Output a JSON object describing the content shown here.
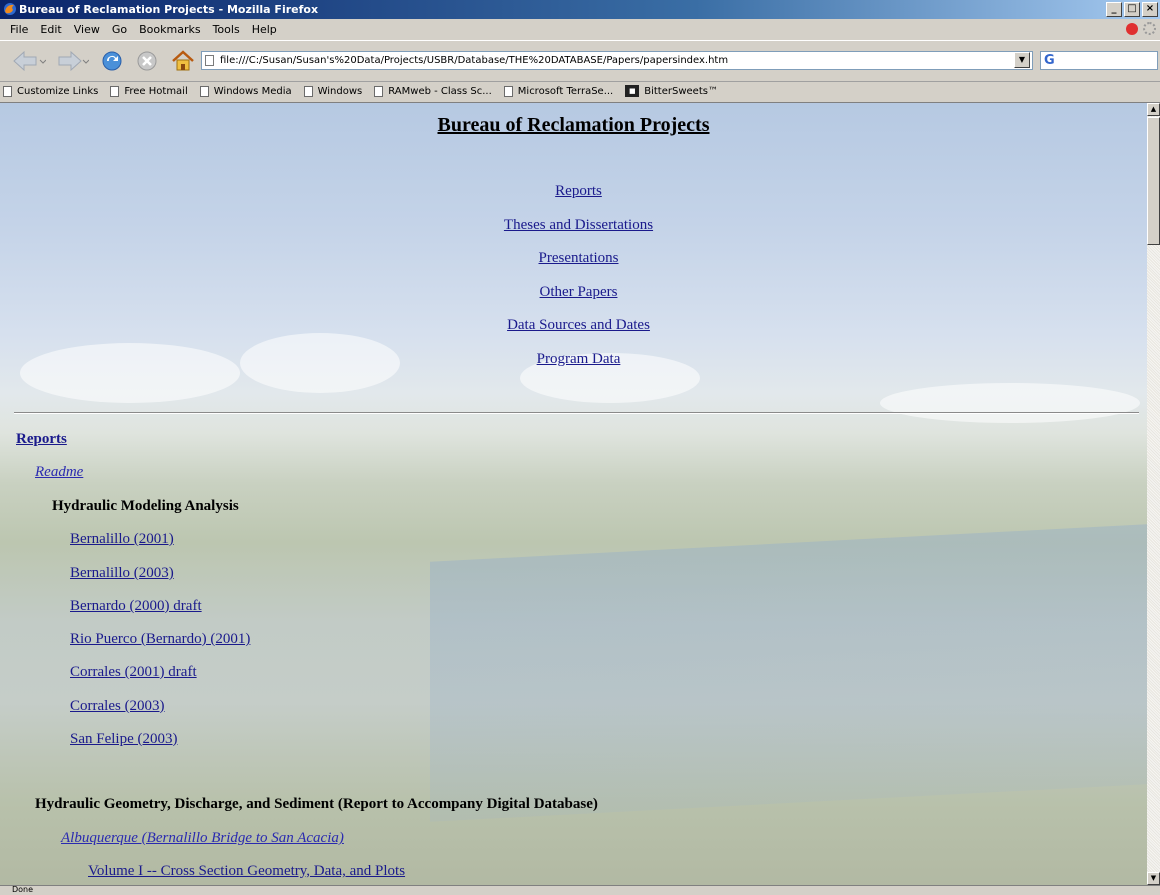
{
  "window": {
    "title": "Bureau of Reclamation Projects - Mozilla Firefox",
    "minimize": "_",
    "maximize": "□",
    "close": "×"
  },
  "menu": [
    "File",
    "Edit",
    "View",
    "Go",
    "Bookmarks",
    "Tools",
    "Help"
  ],
  "address": {
    "url": "file:///C:/Susan/Susan's%20Data/Projects/USBR/Database/THE%20DATABASE/Papers/papersindex.htm",
    "dropdown": "▼"
  },
  "search": {
    "icon": "G"
  },
  "bookmarks": [
    "Customize Links",
    "Free Hotmail",
    "Windows Media",
    "Windows",
    "RAMweb - Class Sc...",
    "Microsoft TerraSe...",
    "BitterSweets™"
  ],
  "page": {
    "title": "Bureau of Reclamation Projects",
    "nav_links": [
      "Reports",
      "Theses and Dissertations",
      "Presentations",
      "Other Papers",
      "Data Sources and Dates",
      "Program Data"
    ],
    "section_reports": "Reports",
    "readme": "Readme",
    "hma_heading": "Hydraulic Modeling Analysis",
    "hma_reports": [
      "Bernalillo (2001)",
      "Bernalillo (2003)",
      "Bernardo (2000) draft",
      "Rio Puerco (Bernardo) (2001)",
      "Corrales (2001) draft",
      "Corrales (2003)",
      "San Felipe (2003)"
    ],
    "hgds_heading": "Hydraulic Geometry, Discharge, and Sediment (Report to Accompany Digital Database)",
    "albuquerque": "Albuquerque (Bernalillo Bridge to San Acacia)",
    "volume1": "Volume I -- Cross Section Geometry, Data, and Plots"
  },
  "status": {
    "text": "Done"
  },
  "icons": {
    "back": "back-arrow-icon",
    "forward": "forward-arrow-icon",
    "reload": "reload-icon",
    "stop": "stop-icon",
    "home": "home-icon"
  }
}
